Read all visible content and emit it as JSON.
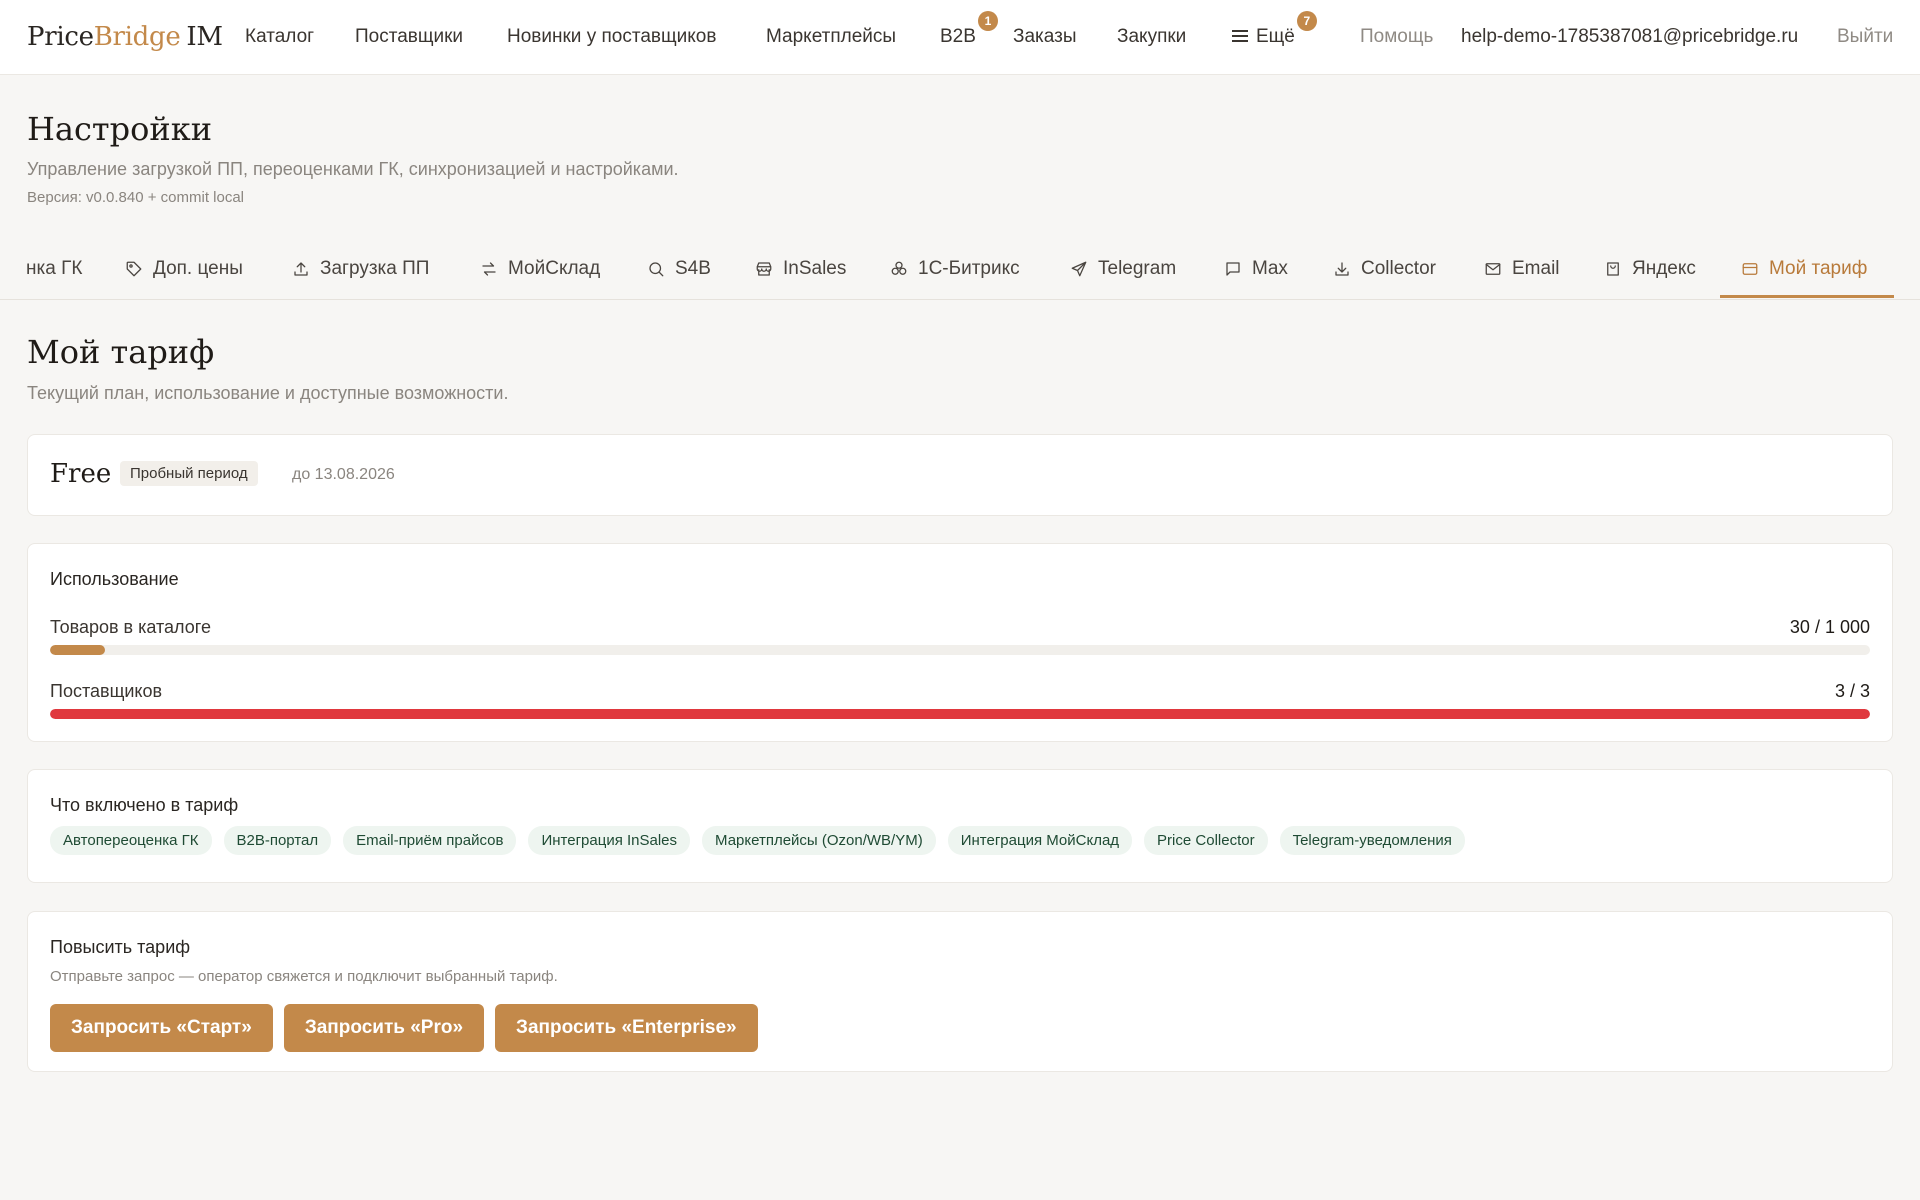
{
  "logo": {
    "part1": "Price",
    "part2": "Bridge",
    "part3": "IM"
  },
  "nav": {
    "items": [
      "Каталог",
      "Поставщики",
      "Новинки у поставщиков",
      "Маркетплейсы",
      "B2B",
      "Заказы",
      "Закупки",
      "Ещё"
    ],
    "b2b_badge": "1",
    "more_badge": "7",
    "help": "Помощь",
    "email": "help-demo-1785387081@pricebridge.ru",
    "logout": "Выйти"
  },
  "header": {
    "title": "Настройки",
    "subtitle": "Управление загрузкой ПП, переоценками ГК, синхронизацией и настройками.",
    "version": "Версия: v0.0.840 + commit local"
  },
  "tabs": [
    "нка ГК",
    "Доп. цены",
    "Загрузка ПП",
    "МойСклад",
    "S4B",
    "InSales",
    "1С-Битрикс",
    "Telegram",
    "Max",
    "Collector",
    "Email",
    "Яндекс",
    "Мой тариф"
  ],
  "tab_icons": [
    "",
    "tag-icon",
    "upload-icon",
    "sync-icon",
    "search-icon",
    "store-icon",
    "cluster-icon",
    "send-icon",
    "message-icon",
    "download-icon",
    "mail-icon",
    "bag-icon",
    "card-icon"
  ],
  "active_tab": "Мой тариф",
  "section": {
    "title": "Мой тариф",
    "subtitle": "Текущий план, использование и доступные возможности."
  },
  "plan": {
    "name": "Free",
    "badge": "Пробный период",
    "until": "до 13.08.2026"
  },
  "usage": {
    "title": "Использование",
    "items": [
      {
        "label": "Товаров в каталоге",
        "value": "30 / 1 000",
        "used": 30,
        "limit": 1000,
        "color": "#c3894a"
      },
      {
        "label": "Поставщиков",
        "value": "3 / 3",
        "used": 3,
        "limit": 3,
        "color": "#e0383e"
      }
    ]
  },
  "included": {
    "title": "Что включено в тариф",
    "features": [
      "Автопереоценка ГК",
      "B2B-портал",
      "Email-приём прайсов",
      "Интеграция InSales",
      "Маркетплейсы (Ozon/WB/YM)",
      "Интеграция МойСклад",
      "Price Collector",
      "Telegram-уведомления"
    ]
  },
  "upgrade": {
    "title": "Повысить тариф",
    "subtitle": "Отправьте запрос — оператор свяжется и подключит выбранный тариф.",
    "buttons": [
      "Запросить «Старт»",
      "Запросить «Pro»",
      "Запросить «Enterprise»"
    ]
  },
  "colors": {
    "accent": "#c3894a",
    "danger": "#e0383e",
    "chip_bg": "#eef5f0"
  }
}
